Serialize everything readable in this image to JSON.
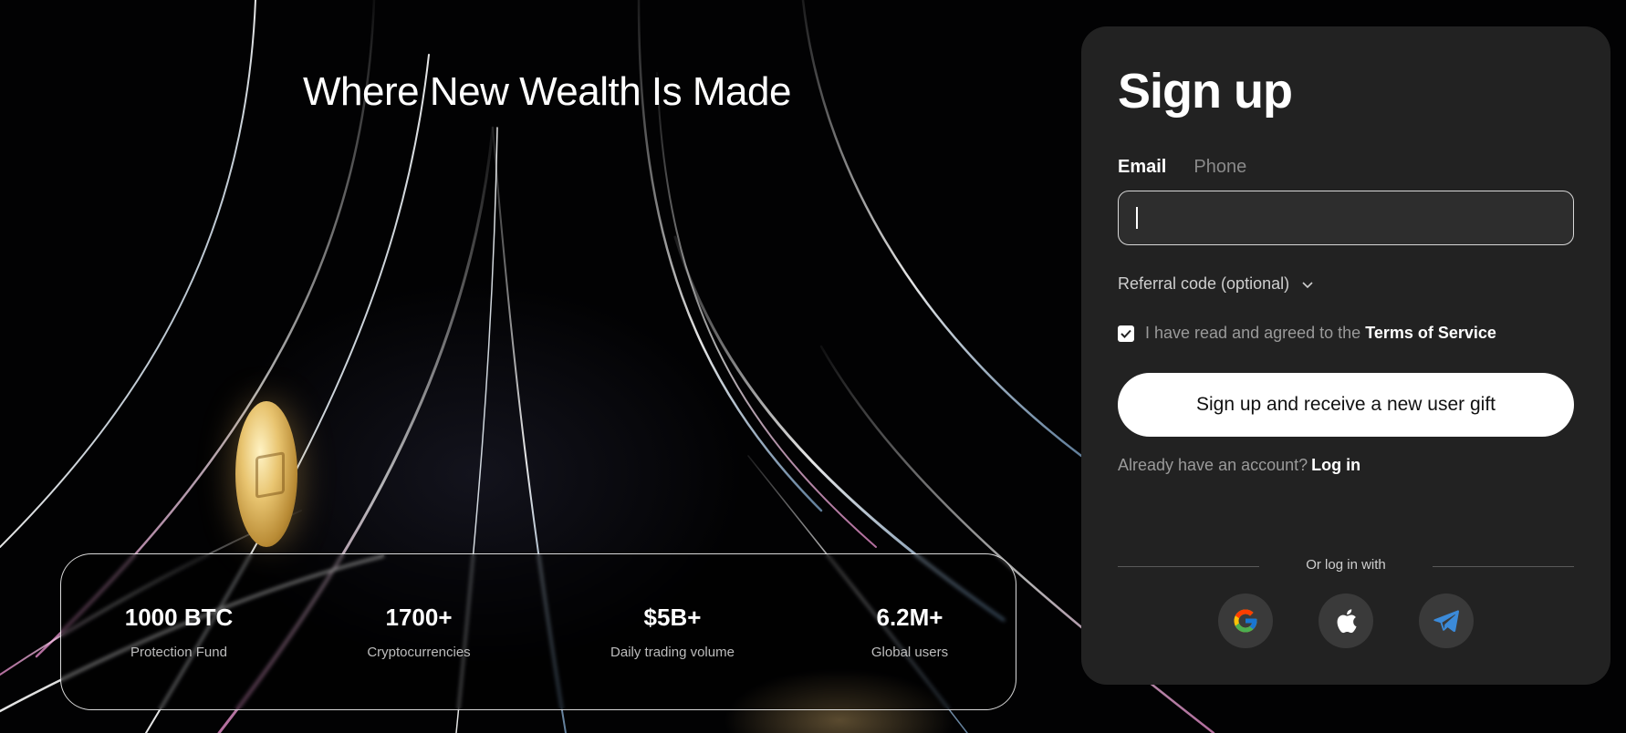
{
  "hero": {
    "title": "Where New Wealth Is Made"
  },
  "stats": [
    {
      "value": "1000 BTC",
      "label": "Protection Fund"
    },
    {
      "value": "1700+",
      "label": "Cryptocurrencies"
    },
    {
      "value": "$5B+",
      "label": "Daily trading volume"
    },
    {
      "value": "6.2M+",
      "label": "Global users"
    }
  ],
  "signup": {
    "title": "Sign up",
    "tabs": [
      {
        "label": "Email",
        "active": true
      },
      {
        "label": "Phone",
        "active": false
      }
    ],
    "email_value": "",
    "referral_label": "Referral code (optional)",
    "agree_text": "I have read and agreed to the ",
    "agree_checked": true,
    "terms_label": "Terms of Service",
    "submit_label": "Sign up and receive a new user gift",
    "already_text": "Already have an account?",
    "login_label": "Log in",
    "or_login_with": "Or log in with",
    "social": [
      {
        "name": "google",
        "icon": "google-icon"
      },
      {
        "name": "apple",
        "icon": "apple-icon"
      },
      {
        "name": "telegram",
        "icon": "telegram-icon"
      }
    ]
  },
  "colors": {
    "background": "#000000",
    "panel": "#222222",
    "input_bg": "#2d2d2d",
    "button_bg": "#ffffff",
    "muted_text": "#9a9a9a",
    "telegram_blue": "#3b8ad9"
  }
}
